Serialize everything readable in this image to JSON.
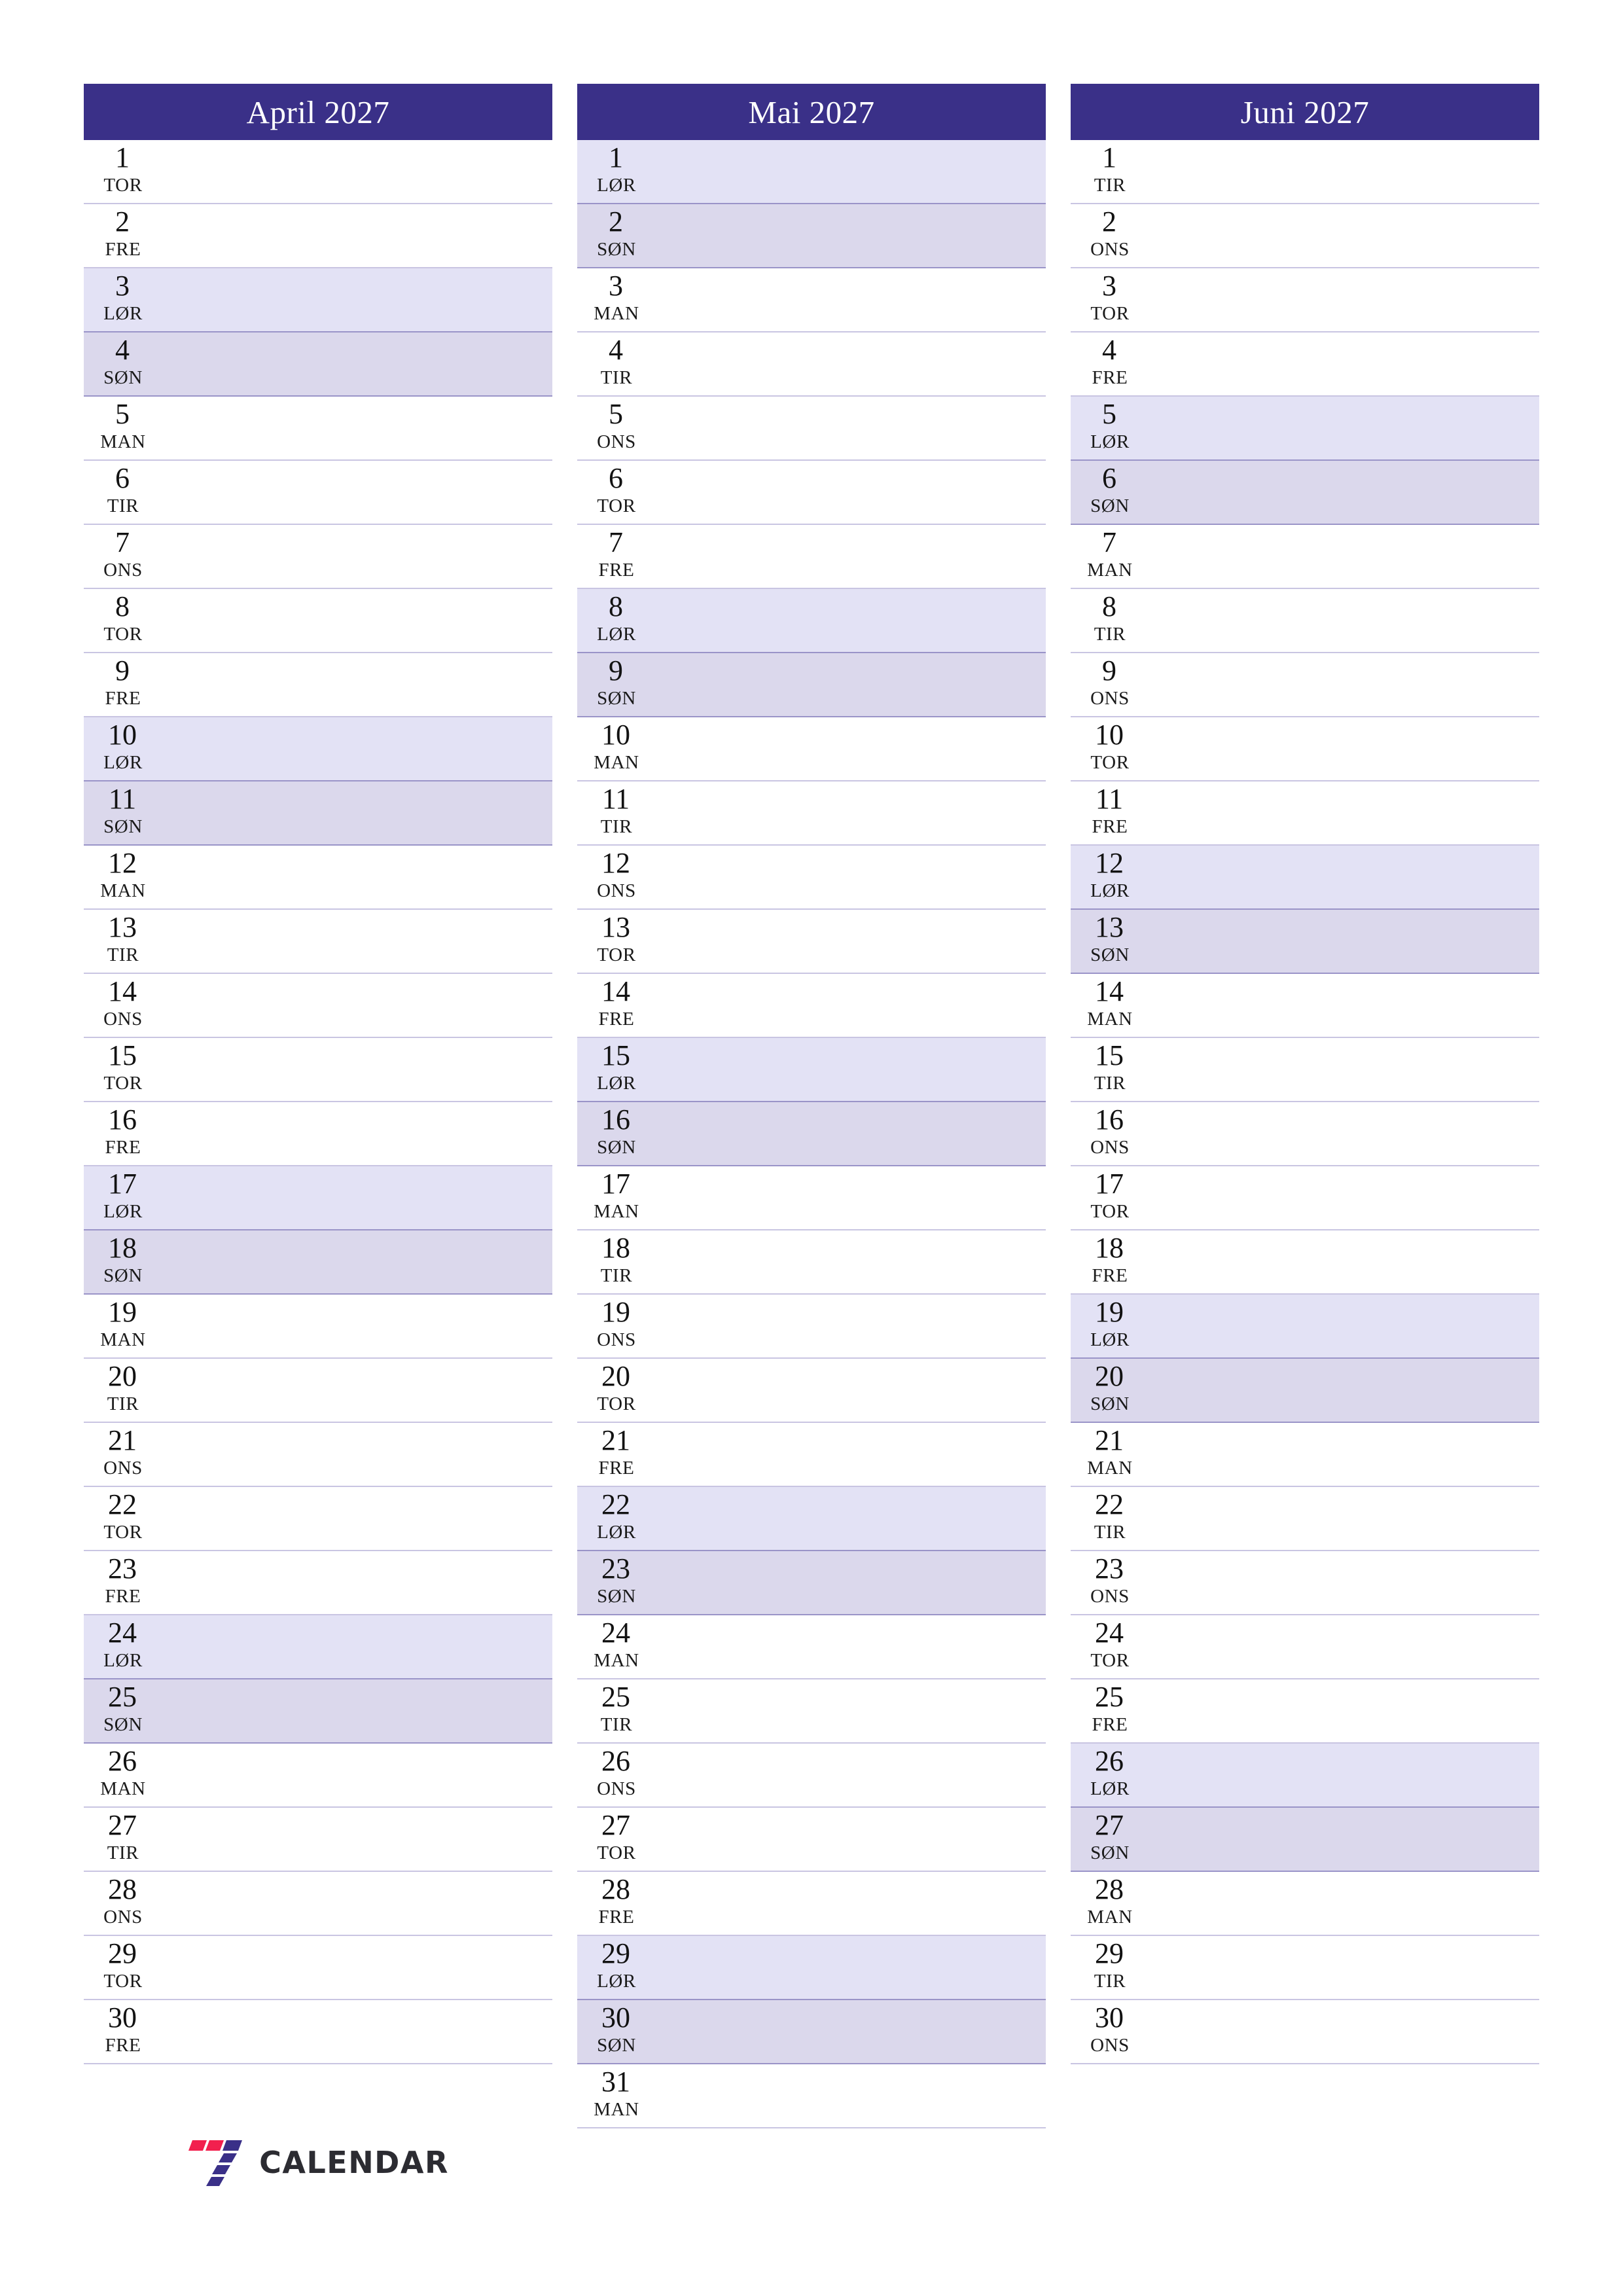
{
  "document": {
    "type": "quarterly-planner",
    "year": "2027",
    "language": "no"
  },
  "colors": {
    "header_bg": "#3a3088",
    "header_text": "#ffffff",
    "saturday_bg": "#e3e2f5",
    "sunday_bg": "#dbd8ec",
    "row_border": "#9a94c8",
    "row_border_light": "#c9c5e2",
    "logo_red": "#f2204e",
    "logo_purple": "#3a3088",
    "logo_text": "#2c2c32",
    "page_bg": "#ffffff"
  },
  "logo": {
    "mark_name": "seven-calendar-logo-icon",
    "text": "CALENDAR"
  },
  "months": [
    {
      "title": "April 2027",
      "days": [
        {
          "num": "1",
          "weekday": "TOR",
          "type": "weekday"
        },
        {
          "num": "2",
          "weekday": "FRE",
          "type": "weekday"
        },
        {
          "num": "3",
          "weekday": "LØR",
          "type": "sat"
        },
        {
          "num": "4",
          "weekday": "SØN",
          "type": "sun"
        },
        {
          "num": "5",
          "weekday": "MAN",
          "type": "weekday"
        },
        {
          "num": "6",
          "weekday": "TIR",
          "type": "weekday"
        },
        {
          "num": "7",
          "weekday": "ONS",
          "type": "weekday"
        },
        {
          "num": "8",
          "weekday": "TOR",
          "type": "weekday"
        },
        {
          "num": "9",
          "weekday": "FRE",
          "type": "weekday"
        },
        {
          "num": "10",
          "weekday": "LØR",
          "type": "sat"
        },
        {
          "num": "11",
          "weekday": "SØN",
          "type": "sun"
        },
        {
          "num": "12",
          "weekday": "MAN",
          "type": "weekday"
        },
        {
          "num": "13",
          "weekday": "TIR",
          "type": "weekday"
        },
        {
          "num": "14",
          "weekday": "ONS",
          "type": "weekday"
        },
        {
          "num": "15",
          "weekday": "TOR",
          "type": "weekday"
        },
        {
          "num": "16",
          "weekday": "FRE",
          "type": "weekday"
        },
        {
          "num": "17",
          "weekday": "LØR",
          "type": "sat"
        },
        {
          "num": "18",
          "weekday": "SØN",
          "type": "sun"
        },
        {
          "num": "19",
          "weekday": "MAN",
          "type": "weekday"
        },
        {
          "num": "20",
          "weekday": "TIR",
          "type": "weekday"
        },
        {
          "num": "21",
          "weekday": "ONS",
          "type": "weekday"
        },
        {
          "num": "22",
          "weekday": "TOR",
          "type": "weekday"
        },
        {
          "num": "23",
          "weekday": "FRE",
          "type": "weekday"
        },
        {
          "num": "24",
          "weekday": "LØR",
          "type": "sat"
        },
        {
          "num": "25",
          "weekday": "SØN",
          "type": "sun"
        },
        {
          "num": "26",
          "weekday": "MAN",
          "type": "weekday"
        },
        {
          "num": "27",
          "weekday": "TIR",
          "type": "weekday"
        },
        {
          "num": "28",
          "weekday": "ONS",
          "type": "weekday"
        },
        {
          "num": "29",
          "weekday": "TOR",
          "type": "weekday"
        },
        {
          "num": "30",
          "weekday": "FRE",
          "type": "weekday"
        }
      ]
    },
    {
      "title": "Mai 2027",
      "days": [
        {
          "num": "1",
          "weekday": "LØR",
          "type": "sat"
        },
        {
          "num": "2",
          "weekday": "SØN",
          "type": "sun"
        },
        {
          "num": "3",
          "weekday": "MAN",
          "type": "weekday"
        },
        {
          "num": "4",
          "weekday": "TIR",
          "type": "weekday"
        },
        {
          "num": "5",
          "weekday": "ONS",
          "type": "weekday"
        },
        {
          "num": "6",
          "weekday": "TOR",
          "type": "weekday"
        },
        {
          "num": "7",
          "weekday": "FRE",
          "type": "weekday"
        },
        {
          "num": "8",
          "weekday": "LØR",
          "type": "sat"
        },
        {
          "num": "9",
          "weekday": "SØN",
          "type": "sun"
        },
        {
          "num": "10",
          "weekday": "MAN",
          "type": "weekday"
        },
        {
          "num": "11",
          "weekday": "TIR",
          "type": "weekday"
        },
        {
          "num": "12",
          "weekday": "ONS",
          "type": "weekday"
        },
        {
          "num": "13",
          "weekday": "TOR",
          "type": "weekday"
        },
        {
          "num": "14",
          "weekday": "FRE",
          "type": "weekday"
        },
        {
          "num": "15",
          "weekday": "LØR",
          "type": "sat"
        },
        {
          "num": "16",
          "weekday": "SØN",
          "type": "sun"
        },
        {
          "num": "17",
          "weekday": "MAN",
          "type": "weekday"
        },
        {
          "num": "18",
          "weekday": "TIR",
          "type": "weekday"
        },
        {
          "num": "19",
          "weekday": "ONS",
          "type": "weekday"
        },
        {
          "num": "20",
          "weekday": "TOR",
          "type": "weekday"
        },
        {
          "num": "21",
          "weekday": "FRE",
          "type": "weekday"
        },
        {
          "num": "22",
          "weekday": "LØR",
          "type": "sat"
        },
        {
          "num": "23",
          "weekday": "SØN",
          "type": "sun"
        },
        {
          "num": "24",
          "weekday": "MAN",
          "type": "weekday"
        },
        {
          "num": "25",
          "weekday": "TIR",
          "type": "weekday"
        },
        {
          "num": "26",
          "weekday": "ONS",
          "type": "weekday"
        },
        {
          "num": "27",
          "weekday": "TOR",
          "type": "weekday"
        },
        {
          "num": "28",
          "weekday": "FRE",
          "type": "weekday"
        },
        {
          "num": "29",
          "weekday": "LØR",
          "type": "sat"
        },
        {
          "num": "30",
          "weekday": "SØN",
          "type": "sun"
        },
        {
          "num": "31",
          "weekday": "MAN",
          "type": "weekday"
        }
      ]
    },
    {
      "title": "Juni 2027",
      "days": [
        {
          "num": "1",
          "weekday": "TIR",
          "type": "weekday"
        },
        {
          "num": "2",
          "weekday": "ONS",
          "type": "weekday"
        },
        {
          "num": "3",
          "weekday": "TOR",
          "type": "weekday"
        },
        {
          "num": "4",
          "weekday": "FRE",
          "type": "weekday"
        },
        {
          "num": "5",
          "weekday": "LØR",
          "type": "sat"
        },
        {
          "num": "6",
          "weekday": "SØN",
          "type": "sun"
        },
        {
          "num": "7",
          "weekday": "MAN",
          "type": "weekday"
        },
        {
          "num": "8",
          "weekday": "TIR",
          "type": "weekday"
        },
        {
          "num": "9",
          "weekday": "ONS",
          "type": "weekday"
        },
        {
          "num": "10",
          "weekday": "TOR",
          "type": "weekday"
        },
        {
          "num": "11",
          "weekday": "FRE",
          "type": "weekday"
        },
        {
          "num": "12",
          "weekday": "LØR",
          "type": "sat"
        },
        {
          "num": "13",
          "weekday": "SØN",
          "type": "sun"
        },
        {
          "num": "14",
          "weekday": "MAN",
          "type": "weekday"
        },
        {
          "num": "15",
          "weekday": "TIR",
          "type": "weekday"
        },
        {
          "num": "16",
          "weekday": "ONS",
          "type": "weekday"
        },
        {
          "num": "17",
          "weekday": "TOR",
          "type": "weekday"
        },
        {
          "num": "18",
          "weekday": "FRE",
          "type": "weekday"
        },
        {
          "num": "19",
          "weekday": "LØR",
          "type": "sat"
        },
        {
          "num": "20",
          "weekday": "SØN",
          "type": "sun"
        },
        {
          "num": "21",
          "weekday": "MAN",
          "type": "weekday"
        },
        {
          "num": "22",
          "weekday": "TIR",
          "type": "weekday"
        },
        {
          "num": "23",
          "weekday": "ONS",
          "type": "weekday"
        },
        {
          "num": "24",
          "weekday": "TOR",
          "type": "weekday"
        },
        {
          "num": "25",
          "weekday": "FRE",
          "type": "weekday"
        },
        {
          "num": "26",
          "weekday": "LØR",
          "type": "sat"
        },
        {
          "num": "27",
          "weekday": "SØN",
          "type": "sun"
        },
        {
          "num": "28",
          "weekday": "MAN",
          "type": "weekday"
        },
        {
          "num": "29",
          "weekday": "TIR",
          "type": "weekday"
        },
        {
          "num": "30",
          "weekday": "ONS",
          "type": "weekday"
        }
      ]
    }
  ]
}
